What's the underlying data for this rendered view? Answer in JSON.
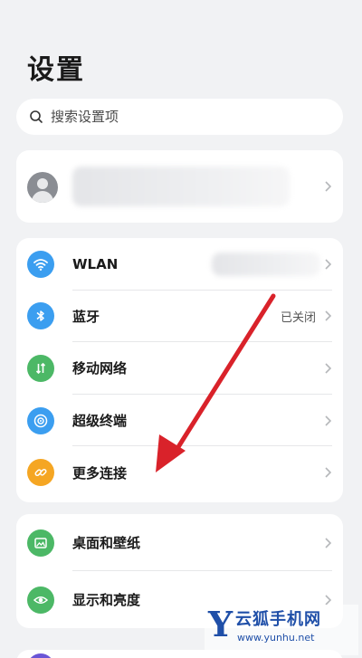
{
  "page": {
    "title": "设置"
  },
  "search": {
    "placeholder": "搜索设置项"
  },
  "connectivity": {
    "items": [
      {
        "label": "WLAN",
        "value": "",
        "icon": "wifi-icon",
        "color": "#3b9ef0"
      },
      {
        "label": "蓝牙",
        "value": "已关闭",
        "icon": "bluetooth-icon",
        "color": "#3b9ef0"
      },
      {
        "label": "移动网络",
        "value": "",
        "icon": "mobile-network-icon",
        "color": "#4cb866"
      },
      {
        "label": "超级终端",
        "value": "",
        "icon": "super-device-icon",
        "color": "#3b9ef0"
      },
      {
        "label": "更多连接",
        "value": "",
        "icon": "link-icon",
        "color": "#f5a623"
      }
    ]
  },
  "display": {
    "items": [
      {
        "label": "桌面和壁纸",
        "icon": "wallpaper-icon",
        "color": "#4cb866"
      },
      {
        "label": "显示和亮度",
        "icon": "eye-icon",
        "color": "#4cb866"
      }
    ]
  },
  "annotation": {
    "color": "#d9222a"
  },
  "watermark": {
    "logo": "Y",
    "name": "云狐手机网",
    "url": "www.yunhu.net"
  }
}
